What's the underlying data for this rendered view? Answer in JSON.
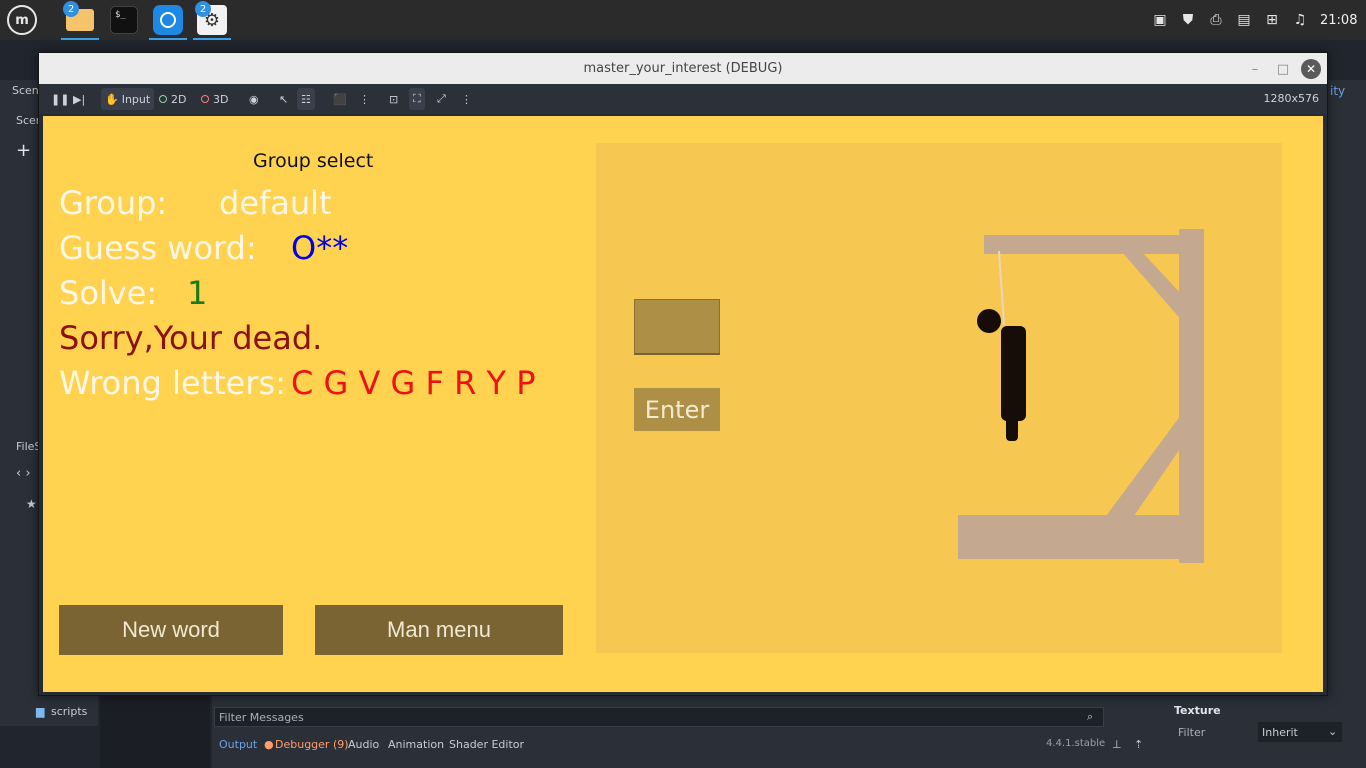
{
  "taskbar": {
    "apps": [
      {
        "name": "Files",
        "icon": "folder-icon",
        "badge": "2"
      },
      {
        "name": "Terminal",
        "icon": "terminal-icon",
        "label": "$_"
      },
      {
        "name": "Browser",
        "icon": "browser-icon"
      },
      {
        "name": "Settings",
        "icon": "gear-icon",
        "badge": "2"
      }
    ],
    "clock": "21:08"
  },
  "editor": {
    "scene_tab": "Scene",
    "scene_dock": "Scen",
    "filesystem_dock": "FileS",
    "file_item": "scripts",
    "filter_placeholder": "Filter Messages",
    "bottom_tabs": {
      "output": "Output",
      "debugger": "Debugger (9)",
      "audio": "Audio",
      "animation": "Animation",
      "shader_editor": "Shader Editor"
    },
    "version": "4.4.1.stable",
    "inspector": {
      "section": "Texture",
      "filter_label": "Filter",
      "filter_value": "Inherit"
    },
    "top_right": "ity"
  },
  "window": {
    "title": "master_your_interest (DEBUG)",
    "toolbar": {
      "input": "Input",
      "mode_2d": "2D",
      "mode_3d": "3D",
      "resolution": "1280x576"
    }
  },
  "game": {
    "title": "Group select",
    "group_label": "Group:",
    "group_value": "default",
    "guess_label": "Guess word:",
    "guess_value": "O**",
    "solve_label": "Solve:",
    "solve_value": "1",
    "status": "Sorry,Your dead.",
    "wrong_label": "Wrong letters:",
    "wrong_value": "C G V G F R Y P",
    "new_word": "New word",
    "main_menu": "Man menu",
    "enter": "Enter",
    "colors": {
      "background": "#ffd34f",
      "guess": "#0000ee",
      "solve": "#1a7a1a",
      "status": "#8b1010",
      "wrong": "#ee1111",
      "gallows": "#c4a990"
    }
  }
}
